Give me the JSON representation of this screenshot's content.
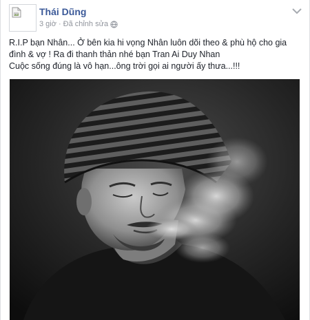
{
  "post": {
    "author": "Thái Dũng",
    "time": "3 giờ",
    "separator": "·",
    "edited": "Đã chỉnh sửa",
    "text_lines": [
      "R.I.P bạn Nhân... Ở bên kia hi vọng Nhân luôn dõi theo & phù hộ cho gia",
      "đình & vợ ! Ra đi thanh thản nhé bạn Tran Ai Duy Nhan",
      "Cuộc sống đúng là vô hạn...ông trời gọi ai người ấy thưa...!!!"
    ],
    "photo_icon": "black-and-white-portrait-photo",
    "options_icon": "chevron-down-icon",
    "meta_icon": "globe-icon"
  },
  "colors": {
    "author_link": "#3b5998",
    "meta_text": "#90949c",
    "body_text": "#1d2129"
  }
}
